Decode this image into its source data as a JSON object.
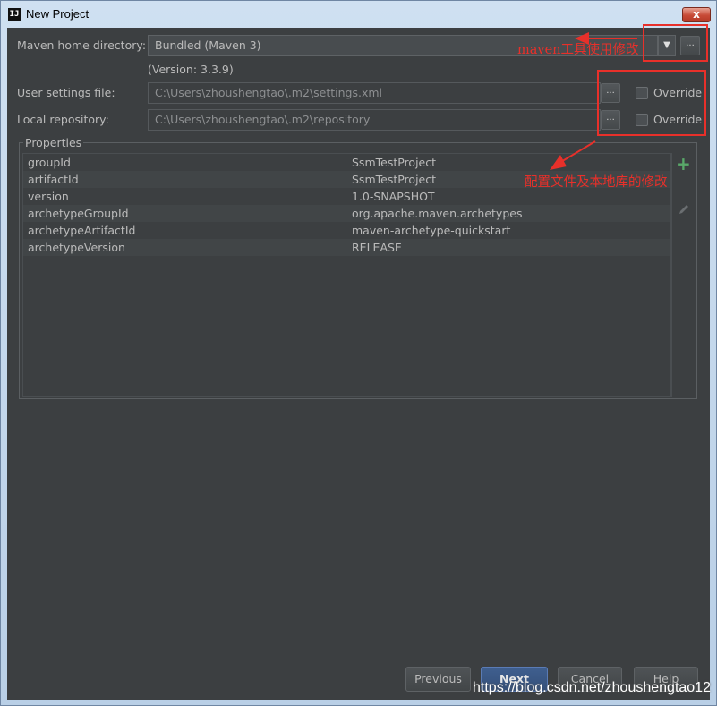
{
  "window": {
    "title": "New Project",
    "close_glyph": "x"
  },
  "form": {
    "maven_home_label": "Maven home directory:",
    "maven_home_value": "Bundled (Maven 3)",
    "maven_version": "(Version: 3.3.9)",
    "user_settings_label": "User settings file:",
    "user_settings_value": "C:\\Users\\zhoushengtao\\.m2\\settings.xml",
    "local_repo_label": "Local repository:",
    "local_repo_value": "C:\\Users\\zhoushengtao\\.m2\\repository",
    "override_label": "Override",
    "browse_glyph": "...",
    "dropdown_glyph": "▼"
  },
  "properties": {
    "title": "Properties",
    "rows": [
      {
        "key": "groupId",
        "value": "SsmTestProject"
      },
      {
        "key": "artifactId",
        "value": "SsmTestProject"
      },
      {
        "key": "version",
        "value": "1.0-SNAPSHOT"
      },
      {
        "key": "archetypeGroupId",
        "value": "org.apache.maven.archetypes"
      },
      {
        "key": "archetypeArtifactId",
        "value": "maven-archetype-quickstart"
      },
      {
        "key": "archetypeVersion",
        "value": "RELEASE"
      }
    ],
    "add_glyph": "+"
  },
  "buttons": {
    "previous": "Previous",
    "next": "Next",
    "cancel": "Cancel",
    "help": "Help"
  },
  "annotations": {
    "maven_note": "maven工具使用修改",
    "config_note": "配置文件及本地库的修改",
    "color": "#e8302a"
  },
  "watermark": "https://blog.csdn.net/zhoushengtao12",
  "colors": {
    "panel": "#3c3f41",
    "text": "#bbbbbb",
    "accent_green": "#59a869"
  }
}
